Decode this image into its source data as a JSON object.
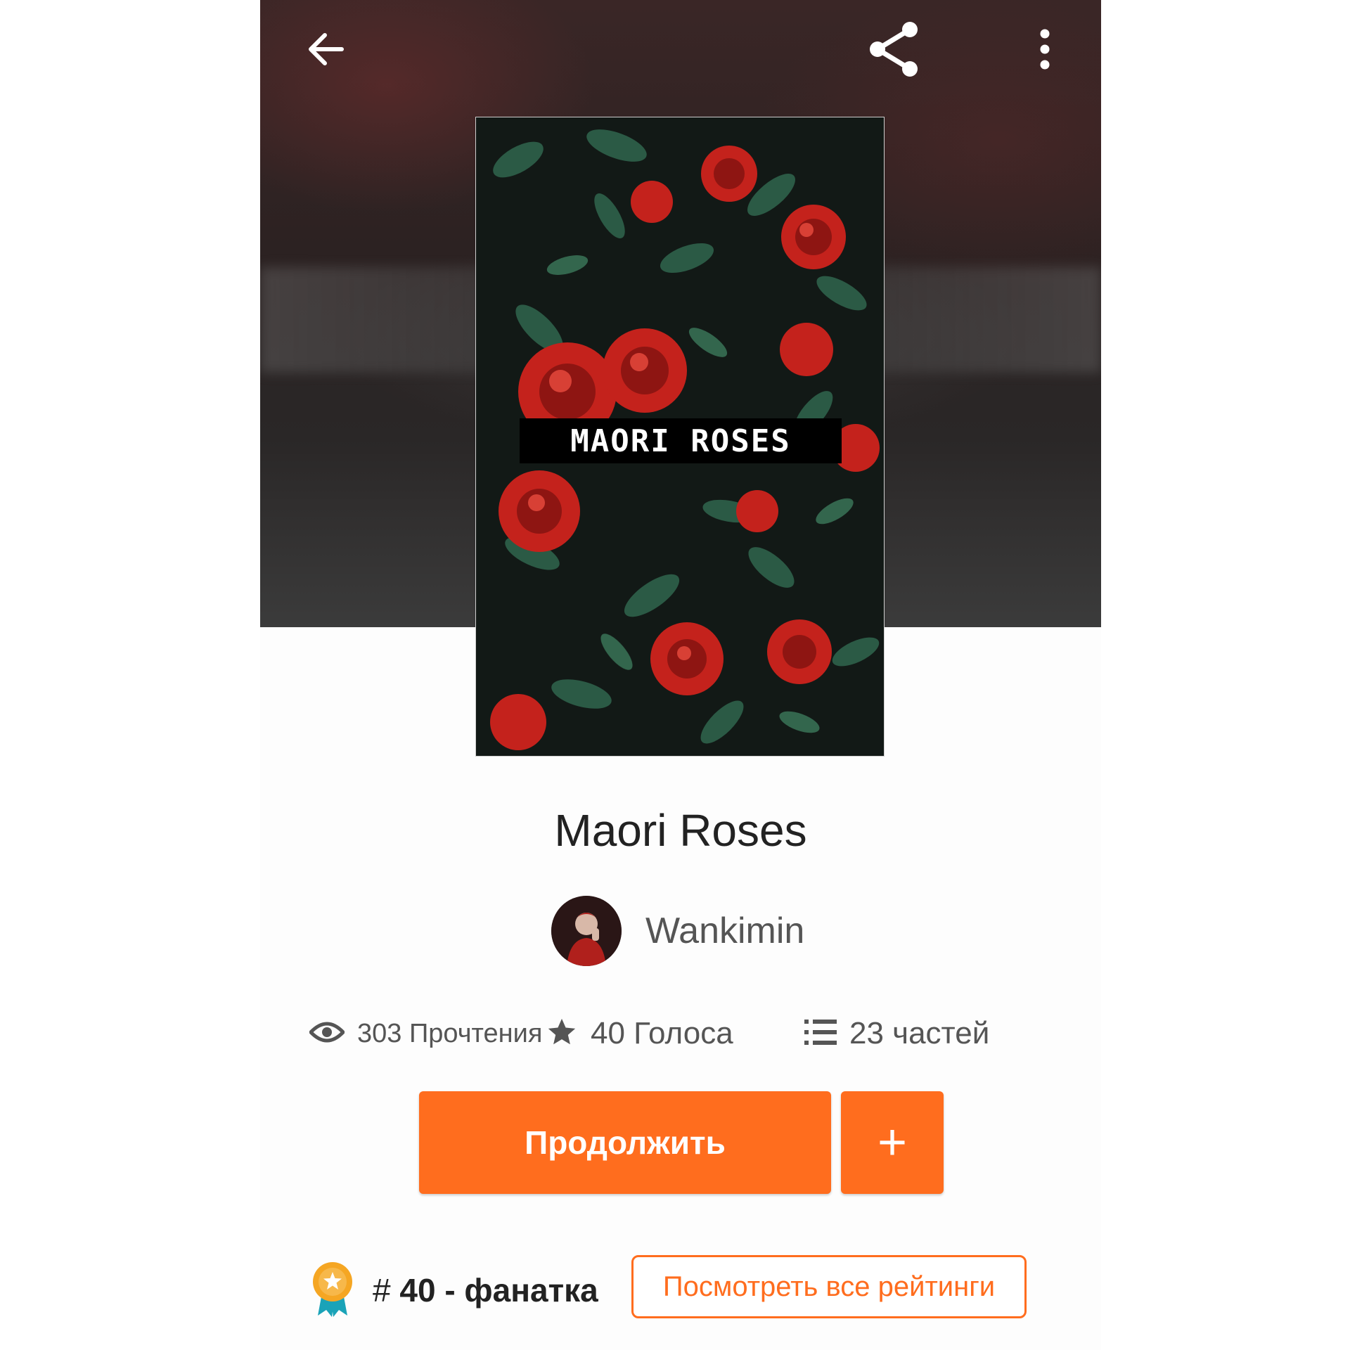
{
  "toolbar": {
    "back_icon": "arrow-left-icon",
    "share_icon": "share-icon",
    "more_icon": "more-vertical-icon"
  },
  "cover": {
    "title_text": "MAORI ROSES"
  },
  "story": {
    "title": "Maori Roses",
    "author": "Wankimin"
  },
  "stats": {
    "reads": "303 Прочтения",
    "votes": "40 Голоса",
    "parts": "23 частей"
  },
  "actions": {
    "continue_label": "Продолжить",
    "add_label": "+"
  },
  "ranking": {
    "hash": "#",
    "rank_label": "40 - фанатка",
    "view_all_label": "Посмотреть все рейтинги"
  },
  "colors": {
    "accent": "#ff6d1e",
    "text_dark": "#222222",
    "text_muted": "#555555",
    "badge_gold": "#f5a623",
    "badge_ribbon": "#1aa3b8"
  }
}
